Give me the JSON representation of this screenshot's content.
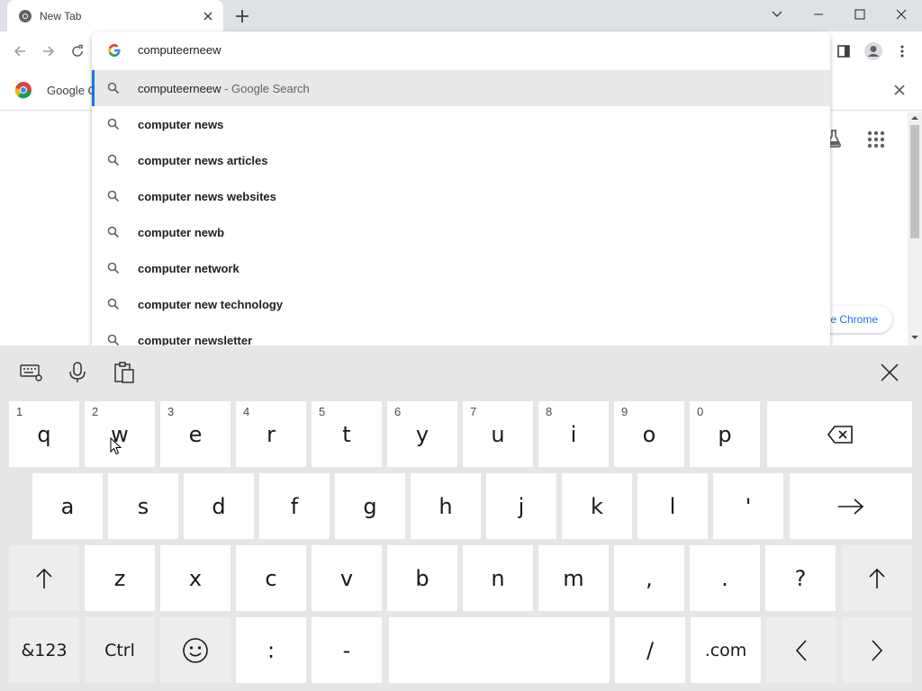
{
  "browser": {
    "tab_title": "New Tab",
    "banner_text": "Google C"
  },
  "omnibox": {
    "input_value": "computeerneew",
    "suggestions": [
      {
        "main": "computeerneew",
        "suffix": " - Google Search"
      },
      {
        "main": "computer news"
      },
      {
        "main": "computer news articles"
      },
      {
        "main": "computer news websites"
      },
      {
        "main": "computer newb"
      },
      {
        "main": "computer network"
      },
      {
        "main": "computer new technology"
      },
      {
        "main": "computer newsletter"
      }
    ]
  },
  "page": {
    "customize_label": "e Chrome"
  },
  "keyboard": {
    "row1": [
      {
        "label": "q",
        "hint": "1"
      },
      {
        "label": "w",
        "hint": "2"
      },
      {
        "label": "e",
        "hint": "3"
      },
      {
        "label": "r",
        "hint": "4"
      },
      {
        "label": "t",
        "hint": "5"
      },
      {
        "label": "y",
        "hint": "6"
      },
      {
        "label": "u",
        "hint": "7"
      },
      {
        "label": "i",
        "hint": "8"
      },
      {
        "label": "o",
        "hint": "9"
      },
      {
        "label": "p",
        "hint": "0"
      }
    ],
    "row2": [
      "a",
      "s",
      "d",
      "f",
      "g",
      "h",
      "j",
      "k",
      "l",
      "'"
    ],
    "row3": [
      "z",
      "x",
      "c",
      "v",
      "b",
      "n",
      "m",
      ",",
      ".",
      "?"
    ],
    "symbols_label": "&123",
    "ctrl_label": "Ctrl",
    "colon_label": ":",
    "dash_label": "-",
    "slash_label": "/",
    "dotcom_label": ".com"
  },
  "colors": {
    "accent": "#1a73e8",
    "keyboard_bg": "#e6e6e6",
    "key_bg": "#ffffff",
    "tabstrip_bg": "#dee1e6"
  }
}
